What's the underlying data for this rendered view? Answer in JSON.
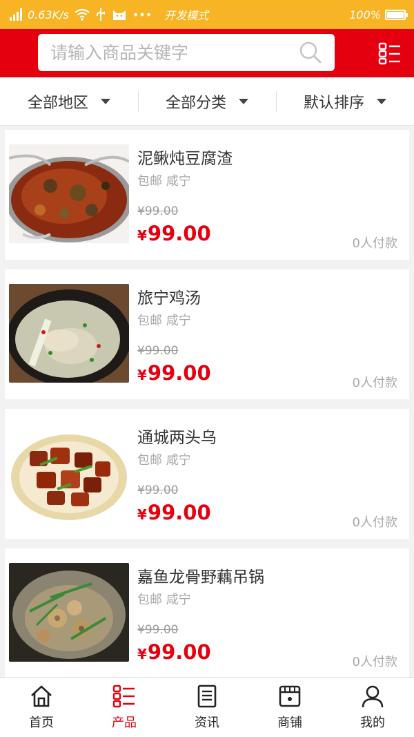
{
  "status_bar": {
    "network_speed": "0.63K/s",
    "mode_label": "开发模式",
    "battery_text": "100%",
    "dots": "•••"
  },
  "search": {
    "placeholder": "请输入商品关键字"
  },
  "filters": [
    {
      "label": "全部地区"
    },
    {
      "label": "全部分类"
    },
    {
      "label": "默认排序"
    }
  ],
  "products": [
    {
      "title": "泥鳅炖豆腐渣",
      "meta": "包邮 咸宁",
      "old_price": "¥99.00",
      "currency": "¥",
      "price": "99.00",
      "paid": "0人付款"
    },
    {
      "title": "旅宁鸡汤",
      "meta": "包邮 咸宁",
      "old_price": "¥99.00",
      "currency": "¥",
      "price": "99.00",
      "paid": "0人付款"
    },
    {
      "title": "通城两头乌",
      "meta": "包邮 咸宁",
      "old_price": "¥99.00",
      "currency": "¥",
      "price": "99.00",
      "paid": "0人付款"
    },
    {
      "title": "嘉鱼龙骨野藕吊锅",
      "meta": "包邮 咸宁",
      "old_price": "¥99.00",
      "currency": "¥",
      "price": "99.00",
      "paid": "0人付款"
    }
  ],
  "nav": [
    {
      "label": "首页",
      "icon": "home-icon",
      "active": false
    },
    {
      "label": "产品",
      "icon": "product-grid-icon",
      "active": true
    },
    {
      "label": "资讯",
      "icon": "news-icon",
      "active": false
    },
    {
      "label": "商铺",
      "icon": "store-icon",
      "active": false
    },
    {
      "label": "我的",
      "icon": "user-icon",
      "active": false
    }
  ],
  "colors": {
    "status_bar": "#f7b425",
    "brand_red": "#e5000f",
    "price_red": "#e5000f",
    "muted_text": "#a8a8a8"
  }
}
